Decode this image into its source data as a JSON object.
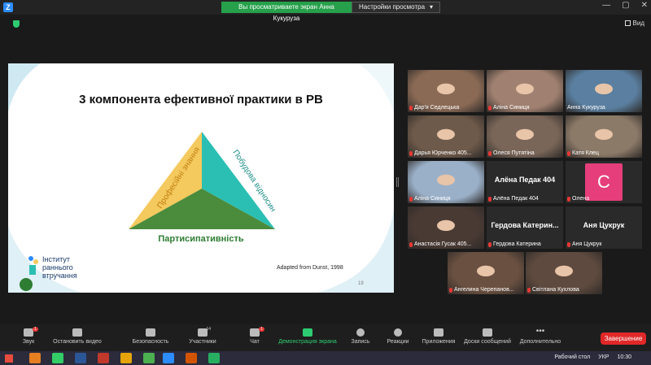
{
  "window": {
    "share_banner": "Вы просматриваете экран Анна Кукуруза",
    "view_settings": "Настройки просмотра",
    "view_label": "Вид"
  },
  "slide": {
    "title": "3 компонента ефективної практики в РВ",
    "left_side": "Професійні знання",
    "right_side": "Побудова відносин",
    "bottom": "Партисипативність",
    "logo_line1": "Інститут",
    "logo_line2": "раннього",
    "logo_line3": "втручання",
    "adapted": "Adapted from Dunst, 1998",
    "page_number": "19",
    "colors": {
      "left": "#f4c95d",
      "right": "#2bbfb3",
      "bottom": "#4a8b3c"
    }
  },
  "participants": [
    {
      "name": "Дар'я Седлецька",
      "muted": true,
      "video": true
    },
    {
      "name": "Аліна Синиця",
      "muted": true,
      "video": true
    },
    {
      "name": "Анна Кукуруза",
      "muted": false,
      "video": true,
      "active": true
    },
    {
      "name": "Дарья Юрченко 405...",
      "muted": true,
      "video": true
    },
    {
      "name": "Олеся Путятіна",
      "muted": true,
      "video": true
    },
    {
      "name": "Катя Клец",
      "muted": true,
      "video": true
    },
    {
      "name": "Аліна Синиця",
      "muted": true,
      "video": true
    },
    {
      "name": "Алёна Педак 404",
      "muted": true,
      "video": false,
      "card": "Алёна Педак 404"
    },
    {
      "name": "Олена",
      "muted": true,
      "video": false,
      "avatar": "C"
    },
    {
      "name": "Анастасія Гусак 405...",
      "muted": true,
      "video": true
    },
    {
      "name": "Гердова Катерина",
      "muted": true,
      "video": false,
      "card": "Гердова  Катерин..."
    },
    {
      "name": "Аня Цукрук",
      "muted": true,
      "video": false,
      "card": "Аня Цукрук"
    },
    {
      "name": "Ангелина Черепанов...",
      "muted": true,
      "video": true
    },
    {
      "name": "Світлана Кухлова",
      "muted": true,
      "video": true
    }
  ],
  "toolbar": {
    "sound": "Звук",
    "sound_badge": "1",
    "video": "Остановить видео",
    "security": "Безопасность",
    "participants": "Участники",
    "participants_count": "14",
    "chat": "Чат",
    "chat_badge": "1",
    "share": "Демонстрация экрана",
    "record": "Запись",
    "reactions": "Реакции",
    "apps": "Приложения",
    "whiteboard": "Доски сообщений",
    "more": "Дополнительно",
    "end": "Завершение"
  },
  "taskbar": {
    "desktop": "Рабочий стол",
    "lang": "УКР",
    "time": "10:30"
  }
}
